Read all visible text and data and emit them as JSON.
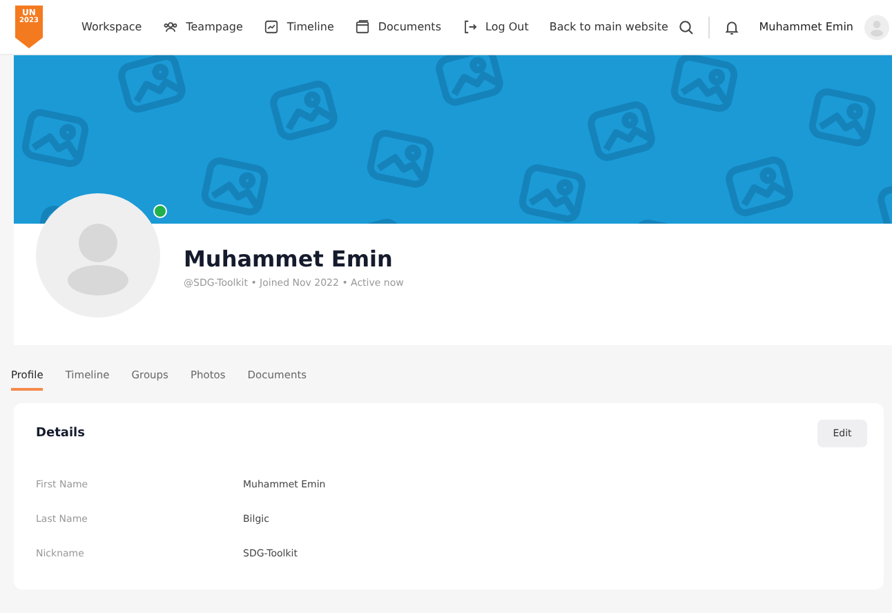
{
  "logo": {
    "lines": [
      "UN",
      "2023"
    ]
  },
  "nav": [
    {
      "label": "Workspace"
    },
    {
      "label": "Teampage"
    },
    {
      "label": "Timeline"
    },
    {
      "label": "Documents"
    },
    {
      "label": "Log Out"
    },
    {
      "label": "Back to main website"
    }
  ],
  "user_menu": {
    "name": "Muhammet Emin"
  },
  "profile": {
    "name": "Muhammet Emin",
    "meta": "@SDG-Toolkit • Joined Nov 2022 • Active now",
    "online": true
  },
  "tabs": [
    {
      "label": "Profile",
      "selected": true
    },
    {
      "label": "Timeline",
      "selected": false
    },
    {
      "label": "Groups",
      "selected": false
    },
    {
      "label": "Photos",
      "selected": false
    },
    {
      "label": "Documents",
      "selected": false
    }
  ],
  "details": {
    "title": "Details",
    "edit_button": "Edit",
    "fields": [
      {
        "label": "First Name",
        "value": "Muhammet Emin"
      },
      {
        "label": "Last Name",
        "value": "Bilgic"
      },
      {
        "label": "Nickname",
        "value": "SDG-Toolkit"
      }
    ]
  }
}
